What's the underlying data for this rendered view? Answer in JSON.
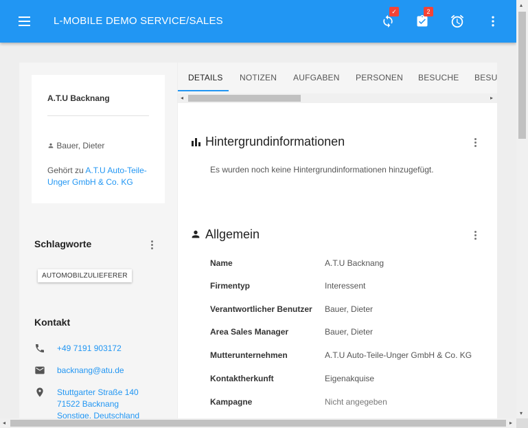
{
  "appbar": {
    "title": "L-MOBILE DEMO SERVICE/SALES",
    "sync_badge": "✓",
    "tasks_badge": "2"
  },
  "company_card": {
    "name": "A.T.U Backnang",
    "user": "Bauer, Dieter",
    "belongs_prefix": "Gehört zu ",
    "belongs_link": "A.T.U Auto-Teile-Unger GmbH & Co. KG"
  },
  "tags": {
    "title": "Schlagworte",
    "items": [
      "AUTOMOBILZULIEFERER"
    ]
  },
  "contact": {
    "title": "Kontakt",
    "phone": "+49 7191 903172",
    "email": "backnang@atu.de",
    "address_line1": "Stuttgarter Straße 140",
    "address_line2": "71522 Backnang",
    "address_line3": "Sonstige, Deutschland"
  },
  "tabs": [
    "DETAILS",
    "NOTIZEN",
    "AUFGABEN",
    "PERSONEN",
    "BESUCHE",
    "BESUC"
  ],
  "background": {
    "title": "Hintergrundinformationen",
    "empty_text": "Es wurden noch keine Hintergrundinformationen hinzugefügt."
  },
  "general": {
    "title": "Allgemein",
    "rows": [
      {
        "label": "Name",
        "value": "A.T.U Backnang"
      },
      {
        "label": "Firmentyp",
        "value": "Interessent"
      },
      {
        "label": "Verantwortlicher Benutzer",
        "value": "Bauer, Dieter"
      },
      {
        "label": "Area Sales Manager",
        "value": "Bauer, Dieter"
      },
      {
        "label": "Mutterunternehmen",
        "value": "A.T.U Auto-Teile-Unger GmbH & Co. KG"
      },
      {
        "label": "Kontaktherkunft",
        "value": "Eigenakquise"
      },
      {
        "label": "Kampagne",
        "value": "Nicht angegeben"
      }
    ]
  },
  "colors": {
    "primary": "#2196f3",
    "badge": "#f44336"
  }
}
